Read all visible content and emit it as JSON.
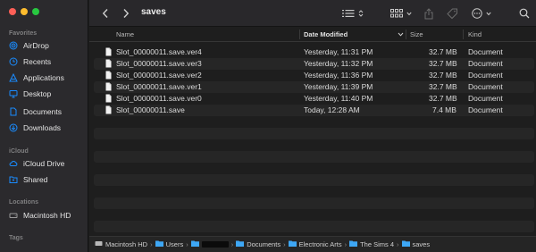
{
  "toolbar": {
    "title": "saves"
  },
  "sidebar": {
    "sections": [
      {
        "label": "Favorites",
        "items": [
          {
            "label": "AirDrop",
            "icon": "airdrop-icon"
          },
          {
            "label": "Recents",
            "icon": "clock-icon"
          },
          {
            "label": "Applications",
            "icon": "applications-icon"
          },
          {
            "label": "Desktop",
            "icon": "desktop-icon"
          },
          {
            "label": "Documents",
            "icon": "document-icon"
          },
          {
            "label": "Downloads",
            "icon": "download-icon"
          }
        ]
      },
      {
        "label": "iCloud",
        "items": [
          {
            "label": "iCloud Drive",
            "icon": "cloud-icon"
          },
          {
            "label": "Shared",
            "icon": "shared-folder-icon"
          }
        ]
      },
      {
        "label": "Locations",
        "items": [
          {
            "label": "Macintosh HD",
            "icon": "disk-icon"
          }
        ]
      },
      {
        "label": "Tags",
        "items": []
      }
    ]
  },
  "columns": {
    "name": "Name",
    "date": "Date Modified",
    "size": "Size",
    "kind": "Kind"
  },
  "files": [
    {
      "name": "Slot_00000011.save.ver4",
      "date": "Yesterday, 11:31 PM",
      "size": "32.7 MB",
      "kind": "Document"
    },
    {
      "name": "Slot_00000011.save.ver3",
      "date": "Yesterday, 11:32 PM",
      "size": "32.7 MB",
      "kind": "Document"
    },
    {
      "name": "Slot_00000011.save.ver2",
      "date": "Yesterday, 11:36 PM",
      "size": "32.7 MB",
      "kind": "Document"
    },
    {
      "name": "Slot_00000011.save.ver1",
      "date": "Yesterday, 11:39 PM",
      "size": "32.7 MB",
      "kind": "Document"
    },
    {
      "name": "Slot_00000011.save.ver0",
      "date": "Yesterday, 11:40 PM",
      "size": "32.7 MB",
      "kind": "Document"
    },
    {
      "name": "Slot_00000011.save",
      "date": "Today, 12:28 AM",
      "size": "7.4 MB",
      "kind": "Document"
    }
  ],
  "pathbar": [
    {
      "label": "Macintosh HD",
      "icon": "disk-icon"
    },
    {
      "label": "Users",
      "icon": "folder-icon"
    },
    {
      "label": "",
      "icon": "home-folder-icon",
      "redacted": true
    },
    {
      "label": "Documents",
      "icon": "folder-icon"
    },
    {
      "label": "Electronic Arts",
      "icon": "folder-icon"
    },
    {
      "label": "The Sims 4",
      "icon": "folder-icon"
    },
    {
      "label": "saves",
      "icon": "folder-icon"
    }
  ],
  "colors": {
    "accent": "#1a8cff",
    "folder": "#3ea7f5",
    "window_bg": "#1e1e1e",
    "sidebar_bg": "#2b2a2d"
  }
}
